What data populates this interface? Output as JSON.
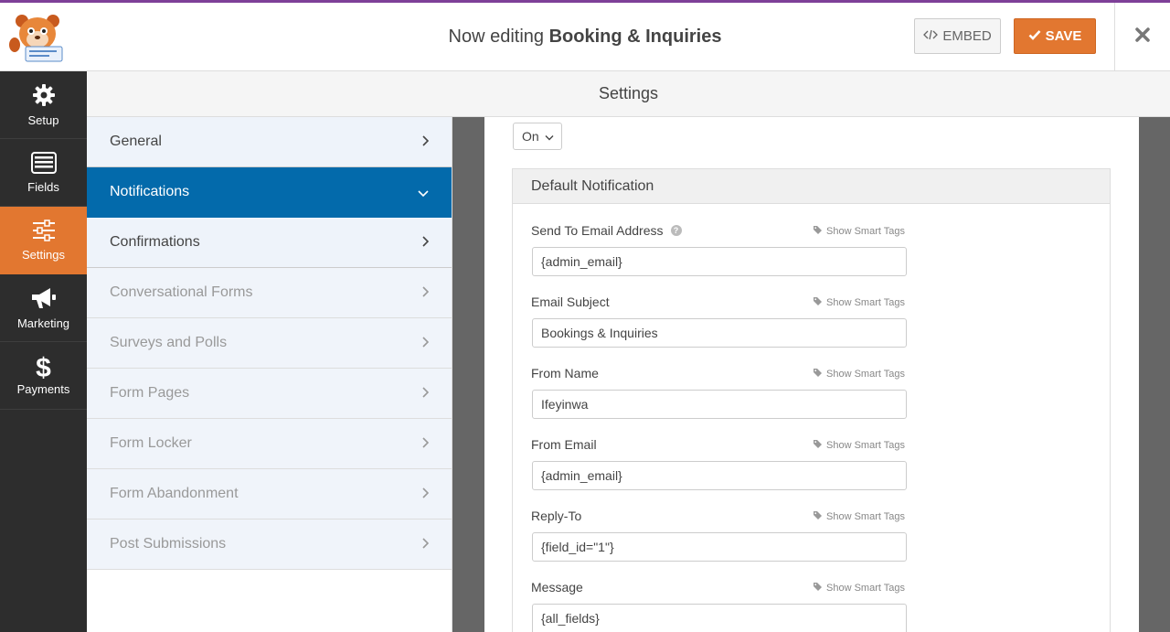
{
  "header": {
    "title_prefix": "Now editing",
    "form_name": "Booking & Inquiries",
    "embed_label": "EMBED",
    "save_label": "SAVE"
  },
  "leftnav": [
    {
      "label": "Setup",
      "icon": "gear-icon"
    },
    {
      "label": "Fields",
      "icon": "list-icon"
    },
    {
      "label": "Settings",
      "icon": "sliders-icon",
      "active": true
    },
    {
      "label": "Marketing",
      "icon": "megaphone-icon"
    },
    {
      "label": "Payments",
      "icon": "dollar-icon"
    }
  ],
  "settings_title": "Settings",
  "submenu": [
    {
      "label": "General"
    },
    {
      "label": "Notifications",
      "active": true
    },
    {
      "label": "Confirmations"
    },
    {
      "label": "Conversational Forms",
      "dim": true
    },
    {
      "label": "Surveys and Polls",
      "dim": true
    },
    {
      "label": "Form Pages",
      "dim": true
    },
    {
      "label": "Form Locker",
      "dim": true
    },
    {
      "label": "Form Abandonment",
      "dim": true
    },
    {
      "label": "Post Submissions",
      "dim": true
    }
  ],
  "notifications": {
    "toggle_value": "On",
    "panel_title": "Default Notification",
    "smart_tags_label": "Show Smart Tags",
    "fields": [
      {
        "label": "Send To Email Address",
        "value": "{admin_email}",
        "help": true
      },
      {
        "label": "Email Subject",
        "value": "Bookings & Inquiries"
      },
      {
        "label": "From Name",
        "value": "Ifeyinwa"
      },
      {
        "label": "From Email",
        "value": "{admin_email}"
      },
      {
        "label": "Reply-To",
        "value": "{field_id=\"1\"}"
      },
      {
        "label": "Message",
        "value": "{all_fields}"
      }
    ]
  },
  "colors": {
    "accent": "#e27730",
    "nav_bg": "#2d2d2d",
    "active_blue": "#036aab",
    "brand_purple": "#7e3f98"
  }
}
